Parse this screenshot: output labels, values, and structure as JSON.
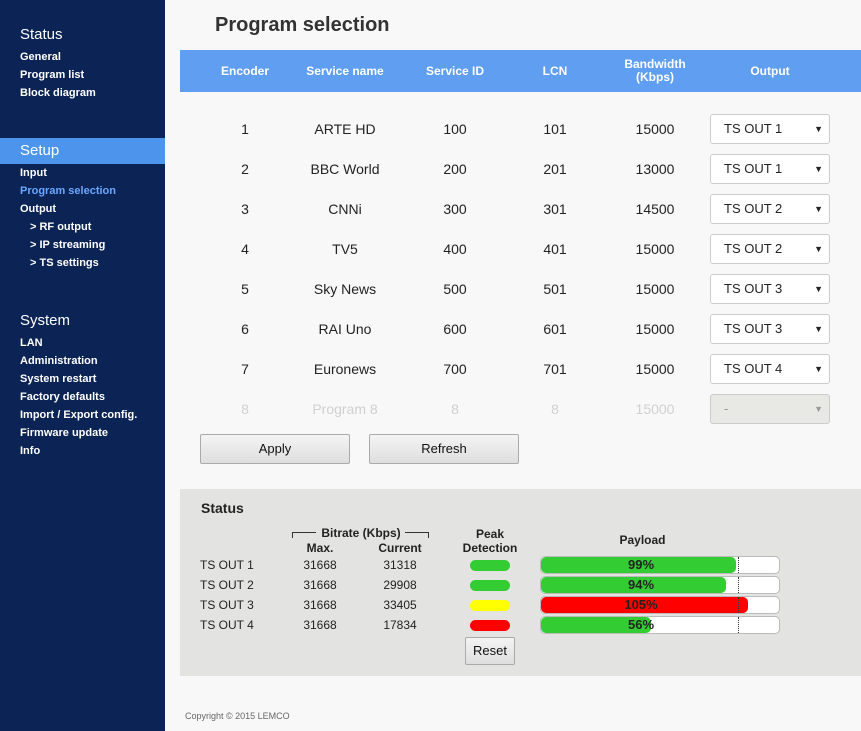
{
  "sidebar": {
    "sections": [
      {
        "title": "Status",
        "items": [
          {
            "label": "General"
          },
          {
            "label": "Program list"
          },
          {
            "label": "Block diagram"
          }
        ]
      },
      {
        "title": "Setup",
        "items": [
          {
            "label": "Input"
          },
          {
            "label": "Program selection"
          },
          {
            "label": "Output"
          },
          {
            "label": "> RF output"
          },
          {
            "label": "> IP streaming"
          },
          {
            "label": "> TS settings"
          }
        ]
      },
      {
        "title": "System",
        "items": [
          {
            "label": "LAN"
          },
          {
            "label": "Administration"
          },
          {
            "label": "System restart"
          },
          {
            "label": "Factory defaults"
          },
          {
            "label": "Import / Export config."
          },
          {
            "label": "Firmware update"
          },
          {
            "label": "Info"
          }
        ]
      }
    ]
  },
  "page": {
    "title": "Program selection"
  },
  "table": {
    "headers": {
      "encoder": "Encoder",
      "service_name": "Service name",
      "service_id": "Service ID",
      "lcn": "LCN",
      "bandwidth_line1": "Bandwidth",
      "bandwidth_line2": "(Kbps)",
      "output": "Output"
    },
    "rows": [
      {
        "encoder": "1",
        "service_name": "ARTE HD",
        "service_id": "100",
        "lcn": "101",
        "bandwidth": "15000",
        "output": "TS OUT 1"
      },
      {
        "encoder": "2",
        "service_name": "BBC World",
        "service_id": "200",
        "lcn": "201",
        "bandwidth": "13000",
        "output": "TS OUT 1"
      },
      {
        "encoder": "3",
        "service_name": "CNNi",
        "service_id": "300",
        "lcn": "301",
        "bandwidth": "14500",
        "output": "TS OUT 2"
      },
      {
        "encoder": "4",
        "service_name": "TV5",
        "service_id": "400",
        "lcn": "401",
        "bandwidth": "15000",
        "output": "TS OUT 2"
      },
      {
        "encoder": "5",
        "service_name": "Sky News",
        "service_id": "500",
        "lcn": "501",
        "bandwidth": "15000",
        "output": "TS OUT 3"
      },
      {
        "encoder": "6",
        "service_name": "RAI Uno",
        "service_id": "600",
        "lcn": "601",
        "bandwidth": "15000",
        "output": "TS OUT 3"
      },
      {
        "encoder": "7",
        "service_name": "Euronews",
        "service_id": "700",
        "lcn": "701",
        "bandwidth": "15000",
        "output": "TS OUT 4"
      },
      {
        "encoder": "8",
        "service_name": "Program 8",
        "service_id": "8",
        "lcn": "8",
        "bandwidth": "15000",
        "output": "-"
      }
    ],
    "dropdown_arrow": "▼"
  },
  "buttons": {
    "apply": "Apply",
    "refresh": "Refresh",
    "reset": "Reset"
  },
  "status": {
    "title": "Status",
    "bitrate_label": "Bitrate (Kbps)",
    "max_label": "Max.",
    "current_label": "Current",
    "peak_line1": "Peak",
    "peak_line2": "Detection",
    "payload_label": "Payload",
    "rows": [
      {
        "name": "TS OUT 1",
        "max": "31668",
        "current": "31318",
        "peak_color": "#33cc33",
        "payload": "99%",
        "payload_fraction": 0.99,
        "payload_color": "#33cc33"
      },
      {
        "name": "TS OUT 2",
        "max": "31668",
        "current": "29908",
        "peak_color": "#33cc33",
        "payload": "94%",
        "payload_fraction": 0.94,
        "payload_color": "#33cc33"
      },
      {
        "name": "TS OUT 3",
        "max": "31668",
        "current": "33405",
        "peak_color": "#ffff00",
        "payload": "105%",
        "payload_fraction": 1.05,
        "payload_color": "#ff0000"
      },
      {
        "name": "TS OUT 4",
        "max": "31668",
        "current": "17834",
        "peak_color": "#ff0000",
        "payload": "56%",
        "payload_fraction": 0.56,
        "payload_color": "#33cc33"
      }
    ]
  },
  "footer": {
    "copyright": "Copyright © 2015 LEMCO"
  },
  "colors": {
    "sidebar_bg": "#0b2355",
    "accent": "#4d95ec",
    "header_bg": "#5f9ef0",
    "current_link": "#6aa8ff"
  }
}
